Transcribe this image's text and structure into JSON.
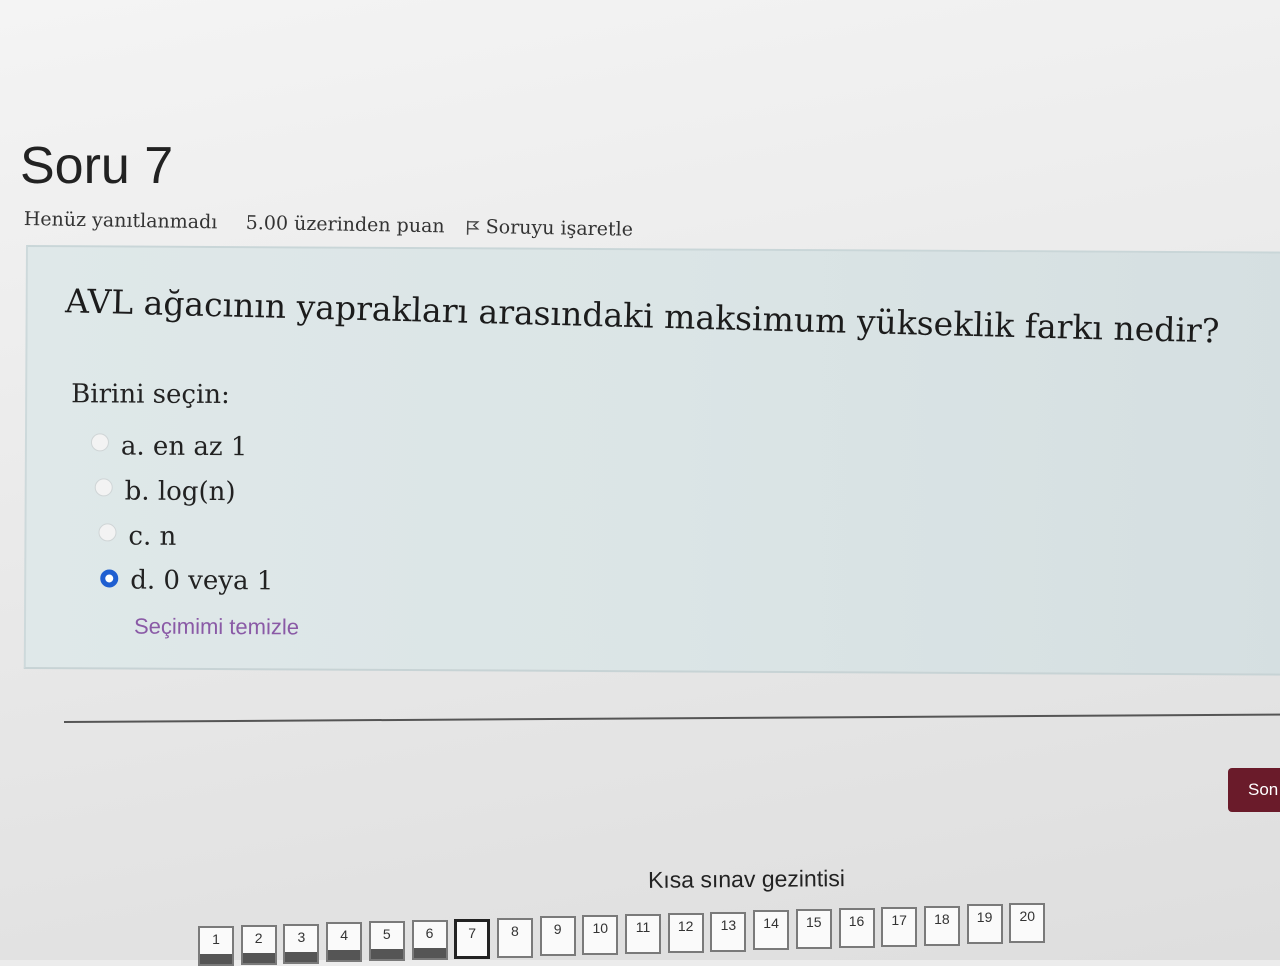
{
  "question": {
    "title": "Soru 7",
    "state": "Henüz yanıtlanmadı",
    "grade": "5.00 üzerinden puan",
    "flag_label": "Soruyu işaretle",
    "text": "AVL ağacının yaprakları arasındaki maksimum yükseklik farkı nedir?",
    "prompt": "Birini seçin:",
    "options": [
      {
        "label": "a. en az 1",
        "selected": false
      },
      {
        "label": "b. log(n)",
        "selected": false
      },
      {
        "label": "c. n",
        "selected": false
      },
      {
        "label": "d. 0 veya 1",
        "selected": true
      }
    ],
    "clear_label": "Seçimimi temizle"
  },
  "footer": {
    "finish_label": "Son"
  },
  "quiz_nav": {
    "title": "Kısa sınav gezintisi",
    "current": "7",
    "buttons": [
      "1",
      "2",
      "3",
      "4",
      "5",
      "6",
      "7",
      "8",
      "9",
      "10",
      "11",
      "12",
      "13",
      "14",
      "15",
      "16",
      "17",
      "18",
      "19",
      "20"
    ]
  }
}
